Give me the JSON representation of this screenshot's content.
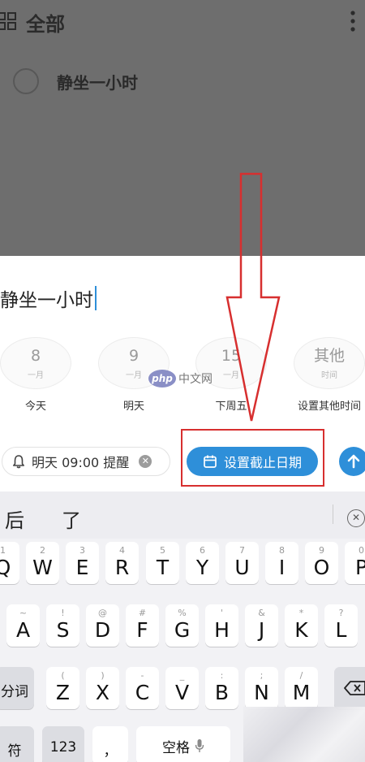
{
  "header": {
    "title": "全部"
  },
  "list": {
    "items": [
      {
        "text": "静坐一小时"
      }
    ]
  },
  "composer": {
    "input_value": "静坐一小时",
    "date_options": [
      {
        "num": "8",
        "month": "一月",
        "label": "今天"
      },
      {
        "num": "9",
        "month": "一月",
        "label": "明天"
      },
      {
        "num": "15",
        "month": "一月",
        "label": "下周五"
      },
      {
        "num": "其他",
        "month": "时间",
        "label": "设置其他时间"
      }
    ],
    "reminder_label": "明天 09:00 提醒",
    "deadline_label": "设置截止日期"
  },
  "watermark": {
    "badge": "php",
    "text": "中文网"
  },
  "keyboard": {
    "candidates": [
      "后",
      "了"
    ],
    "row1": [
      {
        "num": "1",
        "ch": "Q"
      },
      {
        "num": "2",
        "ch": "W"
      },
      {
        "num": "3",
        "ch": "E"
      },
      {
        "num": "4",
        "ch": "R"
      },
      {
        "num": "5",
        "ch": "T"
      },
      {
        "num": "6",
        "ch": "Y"
      },
      {
        "num": "7",
        "ch": "U"
      },
      {
        "num": "8",
        "ch": "I"
      },
      {
        "num": "9",
        "ch": "O"
      },
      {
        "num": "0",
        "ch": "P"
      }
    ],
    "row2": [
      {
        "num": "~",
        "ch": "A"
      },
      {
        "num": "!",
        "ch": "S"
      },
      {
        "num": "@",
        "ch": "D"
      },
      {
        "num": "#",
        "ch": "F"
      },
      {
        "num": "%",
        "ch": "G"
      },
      {
        "num": "'",
        "ch": "H"
      },
      {
        "num": "&",
        "ch": "J"
      },
      {
        "num": "*",
        "ch": "K"
      },
      {
        "num": "?",
        "ch": "L"
      }
    ],
    "row3": [
      {
        "num": "(",
        "ch": "Z"
      },
      {
        "num": ")",
        "ch": "X"
      },
      {
        "num": "-",
        "ch": "C"
      },
      {
        "num": "_",
        "ch": "V"
      },
      {
        "num": ":",
        "ch": "B"
      },
      {
        "num": ";",
        "ch": "N"
      },
      {
        "num": "/",
        "ch": "M"
      }
    ],
    "fenci_label": "分词",
    "symbol_label": "符",
    "num_label": "123",
    "comma_label": "，",
    "space_label": "空格"
  },
  "colors": {
    "accent": "#2e8fd9",
    "annotation_red": "#d72f2f",
    "dim_overlay": "#6e6e6e"
  }
}
